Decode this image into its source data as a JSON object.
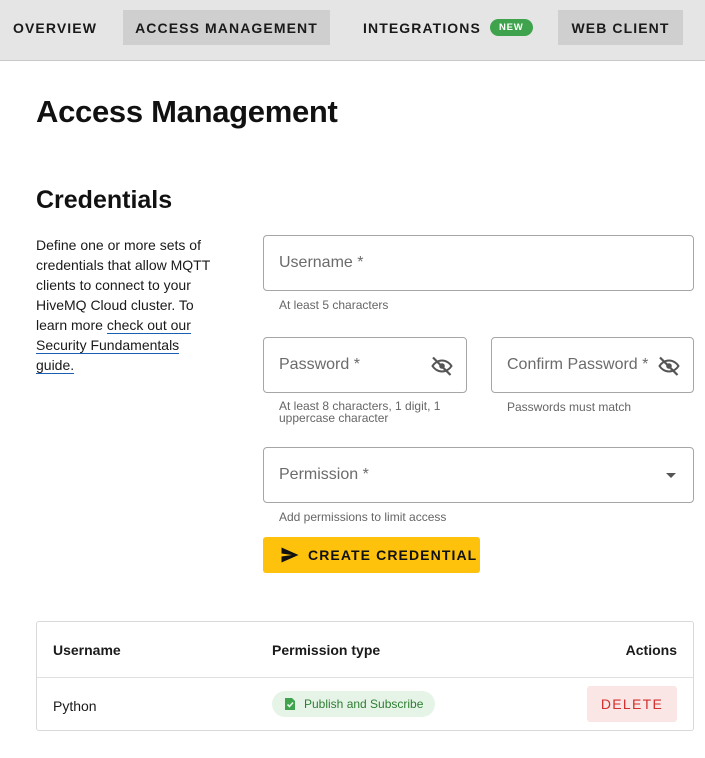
{
  "tabs": {
    "overview": "OVERVIEW",
    "access_management": "ACCESS MANAGEMENT",
    "integrations": "INTEGRATIONS",
    "integrations_badge": "NEW",
    "web_client": "WEB CLIENT"
  },
  "page": {
    "title": "Access Management"
  },
  "credentials": {
    "title": "Credentials",
    "description_prefix": "Define one or more sets of credentials that allow MQTT clients to connect to your HiveMQ Cloud cluster. To learn more ",
    "description_link": "check out our Security Fundamentals guide."
  },
  "form": {
    "username_placeholder": "Username *",
    "username_helper": "At least 5 characters",
    "password_placeholder": "Password *",
    "password_helper": "At least 8 characters, 1 digit, 1 uppercase character",
    "confirm_placeholder": "Confirm Password *",
    "confirm_helper": "Passwords must match",
    "permission_placeholder": "Permission *",
    "permission_helper": "Add permissions to limit access",
    "create_button": "CREATE CREDENTIAL"
  },
  "table": {
    "headers": {
      "username": "Username",
      "permission": "Permission type",
      "actions": "Actions"
    },
    "rows": [
      {
        "username": "Python",
        "permission": "Publish and Subscribe",
        "action": "DELETE"
      }
    ]
  },
  "icons": {
    "password_toggle": "eye-off-icon",
    "confirm_toggle": "eye-off-icon",
    "permission_dropdown": "chevron-down-icon",
    "create": "send-icon",
    "permission_chip": "publish-subscribe-icon"
  },
  "colors": {
    "tab_bar": "#e5e5e5",
    "active_tab": "#cfcfcf",
    "badge_green": "#3fa34d",
    "create_button": "#fec10c",
    "chip_bg": "#e6f4e8",
    "chip_text": "#2e7d32",
    "delete_bg": "#fbe6e6",
    "delete_text": "#d32f2f"
  }
}
